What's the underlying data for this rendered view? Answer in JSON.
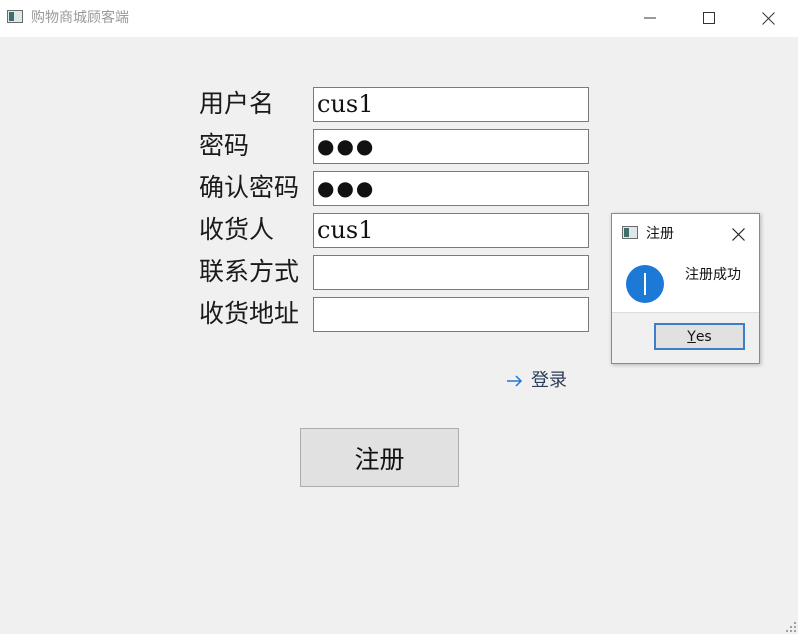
{
  "window": {
    "title": "购物商城顾客端"
  },
  "form": {
    "username_label": "用户名",
    "username_value": "cus1",
    "password_label": "密码",
    "password_value": "●●●",
    "confirm_label": "确认密码",
    "confirm_value": "●●●",
    "receiver_label": "收货人",
    "receiver_value": "cus1",
    "contact_label": "联系方式",
    "contact_value": "",
    "address_label": "收货地址",
    "address_value": ""
  },
  "login_link": {
    "label": "登录"
  },
  "register_button": {
    "label": "注册"
  },
  "dialog": {
    "title": "注册",
    "message": "注册成功",
    "yes_underlined": "Y",
    "yes_rest": "es"
  },
  "colors": {
    "accent": "#1d79d6",
    "background": "#f0f0f0"
  },
  "icons": [
    "app-icon",
    "minimize-icon",
    "maximize-icon",
    "close-icon",
    "arrow-right-icon",
    "info-icon",
    "size-grip-icon"
  ]
}
